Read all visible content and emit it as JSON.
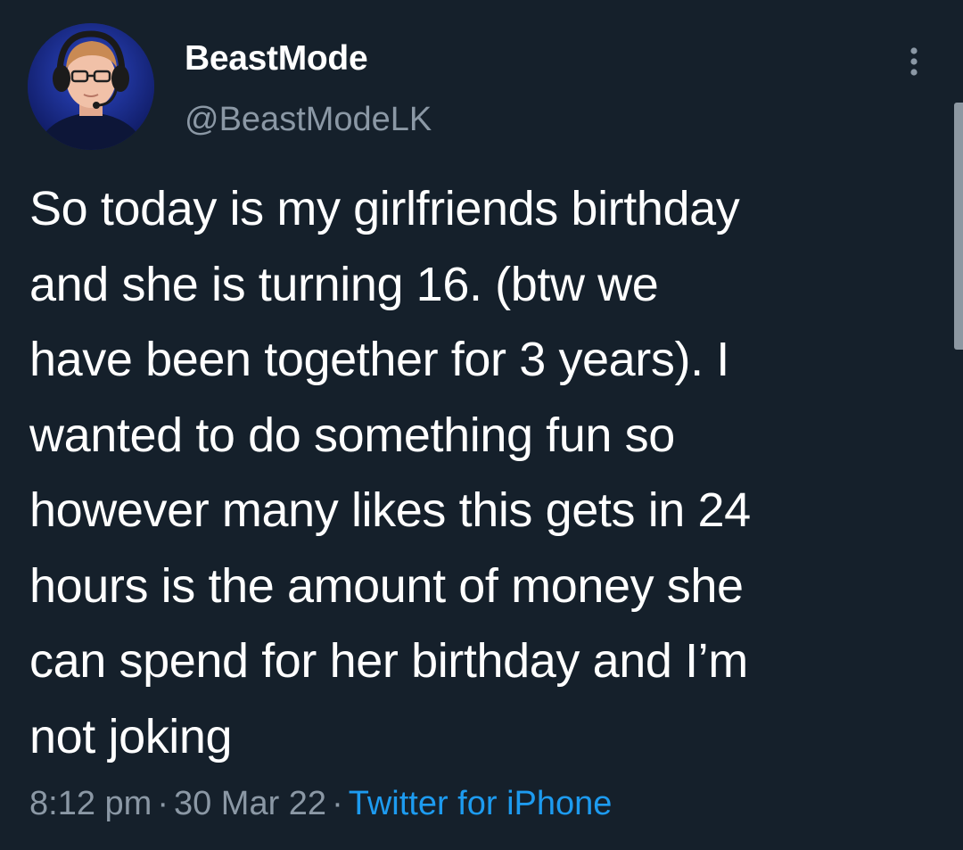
{
  "author": {
    "display_name": "BeastMode",
    "handle": "@BeastModeLK"
  },
  "tweet": {
    "text": "So today is my girlfriends birthday\nand she is turning 16. (btw we\nhave been together for 3 years). I\nwanted to do something fun so\nhowever many likes this gets in 24\nhours is the amount of money she\ncan spend for her birthday and I’m\nnot joking",
    "time": "8:12 pm",
    "date": "30 Mar 22",
    "separator": "·",
    "client": "Twitter for iPhone"
  },
  "icons": {
    "more": "more-vertical-icon",
    "avatar": "avatar-photo"
  },
  "colors": {
    "background": "#15202b",
    "primary_text": "#ffffff",
    "secondary_text": "#8b98a5",
    "link": "#1d9bf0"
  }
}
